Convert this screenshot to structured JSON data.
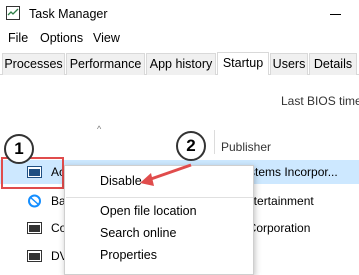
{
  "window": {
    "title": "Task Manager",
    "icon": "task-manager-icon"
  },
  "menubar": {
    "items": [
      "File",
      "Options",
      "View"
    ]
  },
  "tabs": {
    "items": [
      "Processes",
      "Performance",
      "App history",
      "Startup",
      "Users",
      "Details"
    ],
    "active": "Startup"
  },
  "header": {
    "bios_label": "Last BIOS time:",
    "publisher_column": "Publisher",
    "sort_indicator": "^"
  },
  "rows": [
    {
      "name": "Ac",
      "publisher": "e Systems Incorpor...",
      "icon": "app-icon",
      "selected": true
    },
    {
      "name": "Ba",
      "publisher": "rd Entertainment",
      "icon": "battlenet-icon",
      "selected": false
    },
    {
      "name": "Co",
      "publisher": "soft Corporation",
      "icon": "app-icon",
      "selected": false
    },
    {
      "name": "DV",
      "publisher": "",
      "icon": "app-icon",
      "selected": false
    }
  ],
  "context_menu": {
    "items": [
      "Disable",
      "Open file location",
      "Search online",
      "Properties"
    ]
  },
  "annotations": {
    "step1": "1",
    "step2": "2",
    "accent_color": "#e04c4c"
  },
  "colors": {
    "selected_row": "#cde8ff",
    "tab_background": "#f0f0f0"
  }
}
